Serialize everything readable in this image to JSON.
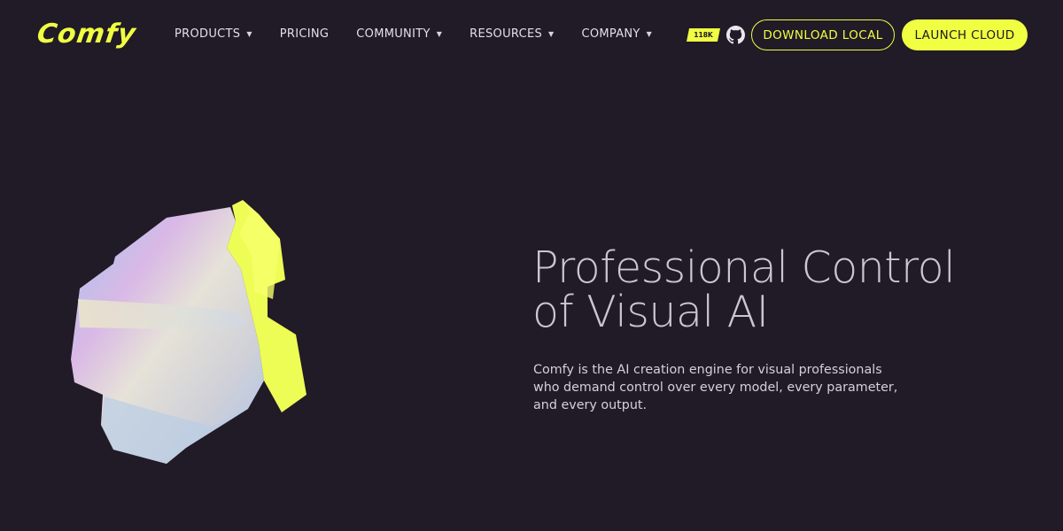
{
  "brand": {
    "logo_text": "Comfy",
    "accent": "#f0ff41",
    "background": "#211a27"
  },
  "nav": {
    "items": [
      {
        "label": "PRODUCTS",
        "has_dropdown": true
      },
      {
        "label": "PRICING",
        "has_dropdown": false
      },
      {
        "label": "COMMUNITY",
        "has_dropdown": true
      },
      {
        "label": "RESOURCES",
        "has_dropdown": true
      },
      {
        "label": "COMPANY",
        "has_dropdown": true
      }
    ],
    "github_stars": "118K",
    "github_icon": "github-icon",
    "download_label": "DOWNLOAD LOCAL",
    "launch_label": "LAUNCH CLOUD"
  },
  "hero": {
    "title_line1": "Professional Control",
    "title_line2": "of Visual AI",
    "subtitle_line1": "Comfy is the AI creation engine for visual professionals",
    "subtitle_line2": "who demand control over every model, every parameter,",
    "subtitle_line3": "and every output."
  }
}
